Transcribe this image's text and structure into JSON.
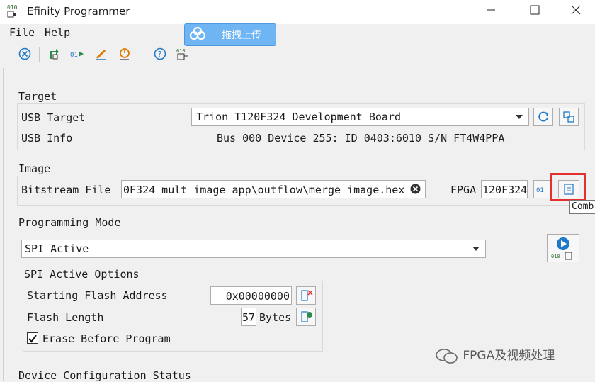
{
  "window": {
    "title": "Efinity Programmer",
    "app_icon_text": [
      "010",
      "01"
    ],
    "controls": [
      "minimize",
      "maximize",
      "close"
    ]
  },
  "overlay_badge": {
    "label": "拖拽上传",
    "color": "#6fb5f4"
  },
  "menu": {
    "items": [
      "File",
      "Help"
    ]
  },
  "toolbar": {
    "icons": [
      "cancel-icon",
      "refresh-target-icon",
      "program-output-icon",
      "edit-icon",
      "timer-icon",
      "help-icon",
      "flash-programmer-icon"
    ]
  },
  "target": {
    "section_label": "Target",
    "usb_target_label": "USB Target",
    "usb_target_value": "Trion T120F324 Development Board",
    "usb_info_label": "USB Info",
    "usb_info_value": "Bus 000 Device 255: ID 0403:6010 S/N FT4W4PPA"
  },
  "image": {
    "section_label": "Image",
    "bitstream_label": "Bitstream File",
    "bitstream_value": "0F324_mult_image_app\\outflow\\merge_image.hex",
    "fpga_label": "FPGA",
    "fpga_value": "120F324",
    "tooltip_text": "Comb"
  },
  "programming_mode": {
    "section_label": "Programming Mode",
    "mode_value": "SPI Active",
    "options_label": "SPI Active Options",
    "start_address_label": "Starting Flash Address",
    "start_address_value": "0x00000000",
    "flash_length_label": "Flash Length",
    "flash_length_value": "57",
    "flash_length_unit": "Bytes",
    "erase_label": "Erase Before Program",
    "erase_checked": true
  },
  "status": {
    "section_label": "Device Configuration Status"
  },
  "watermark": "FPGA及视频处理",
  "colors": {
    "accent_blue": "#1f78c8",
    "highlight_red": "#e53030"
  }
}
